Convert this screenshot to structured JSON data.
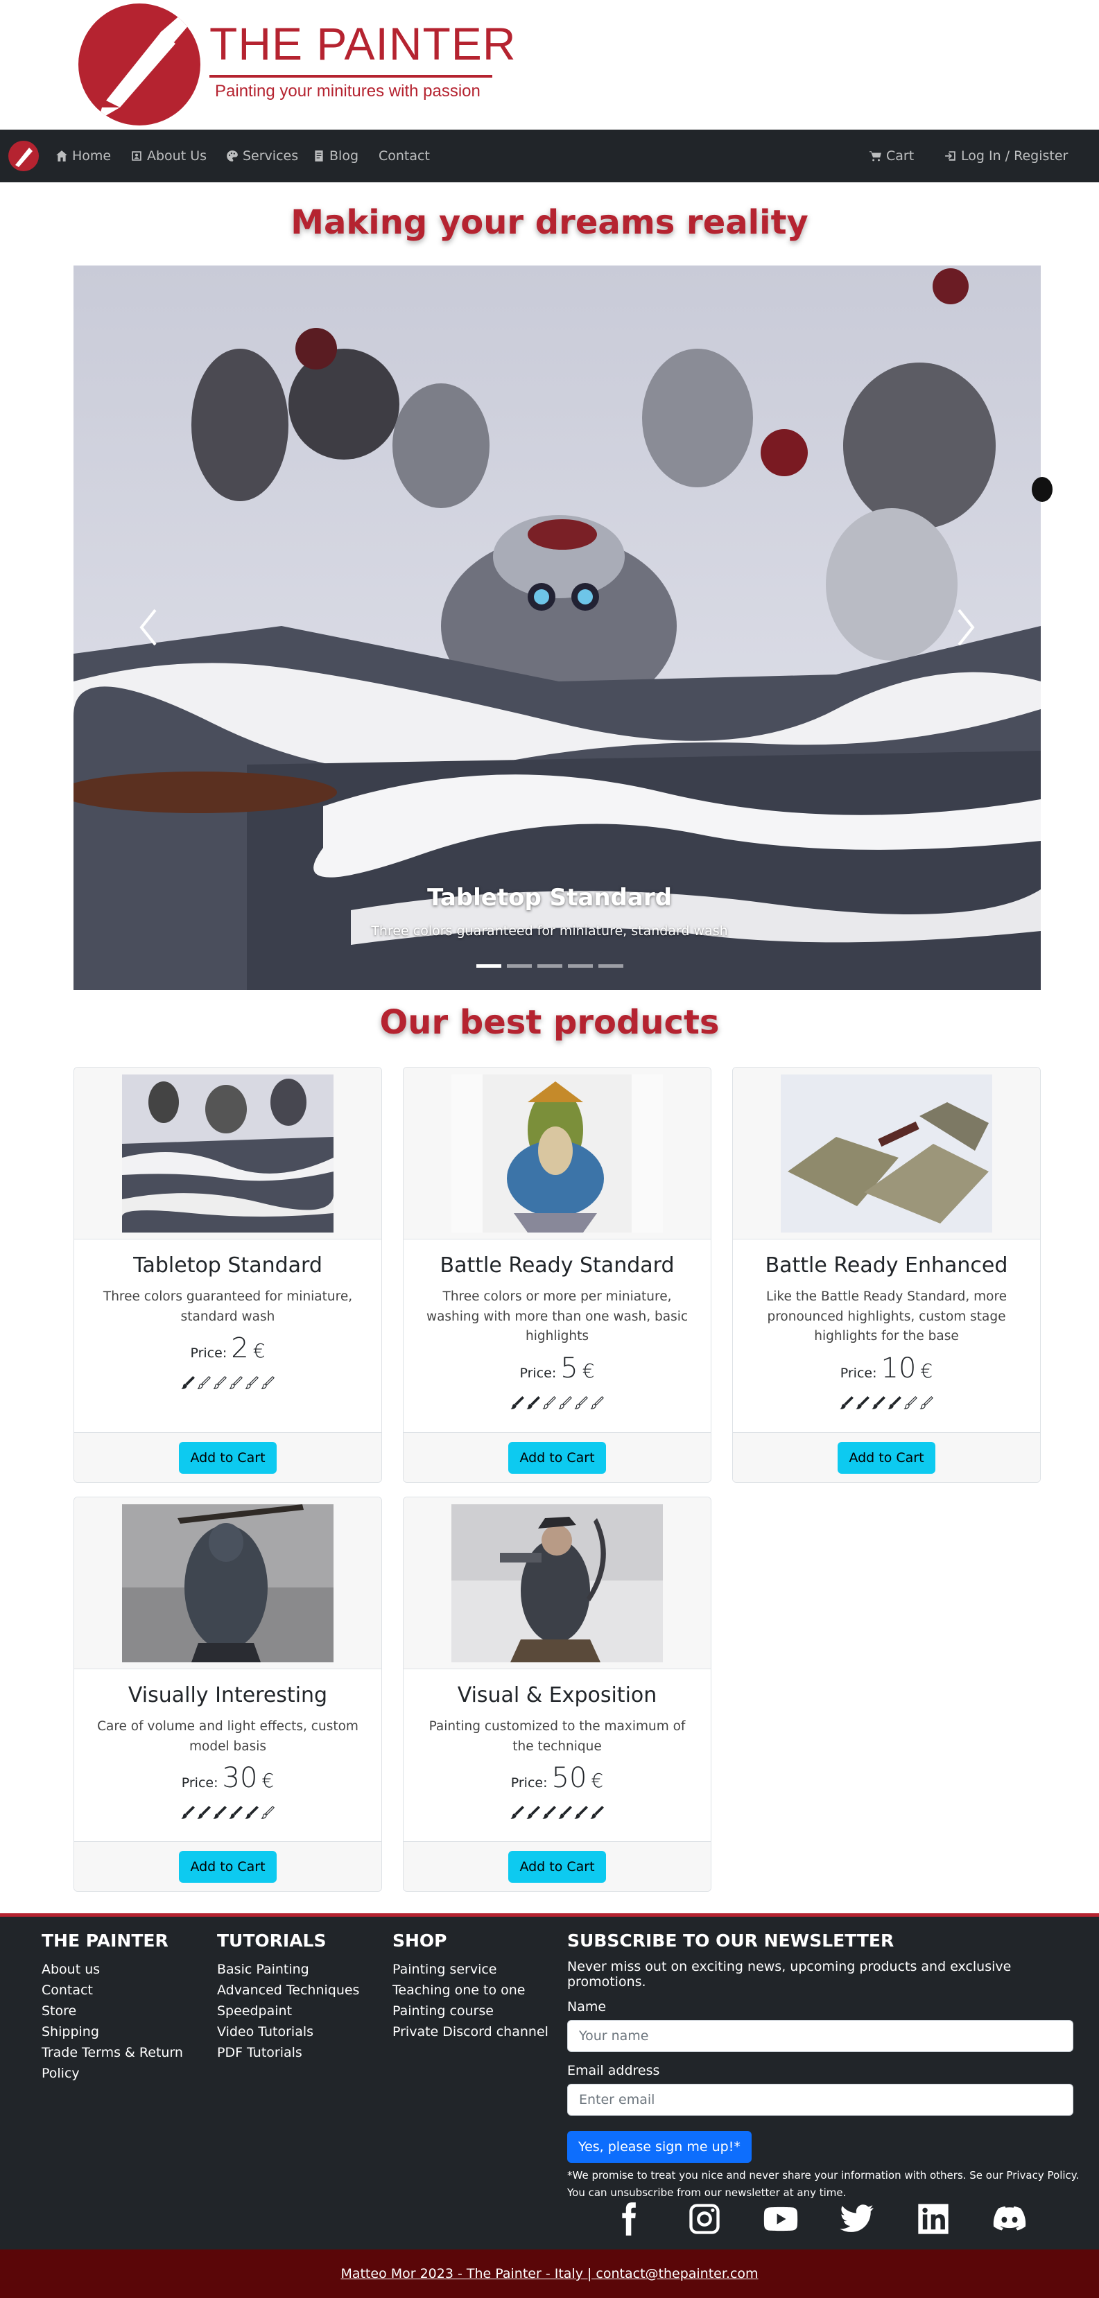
{
  "brand": {
    "title": "THE PAINTER",
    "tagline": "Painting your minitures with passion",
    "color": "#b52330"
  },
  "nav": {
    "items": [
      {
        "label": "Home",
        "icon": "house-icon"
      },
      {
        "label": "About Us",
        "icon": "person-badge-icon"
      },
      {
        "label": "Services",
        "icon": "palette-icon"
      },
      {
        "label": "Blog",
        "icon": "journal-icon"
      },
      {
        "label": "Contact",
        "icon": ""
      }
    ],
    "cart_label": "Cart",
    "login_label": "Log In / Register"
  },
  "hero": {
    "heading": "Making your dreams reality",
    "caption_title": "Tabletop Standard",
    "caption_text": "Three colors guaranteed for miniature, standard wash",
    "indicator_count": 5,
    "active_indicator": 1
  },
  "products": {
    "heading": "Our best products",
    "price_label": "Price:",
    "currency": "€",
    "button_label": "Add to Cart",
    "items": [
      {
        "title": "Tabletop Standard",
        "desc": "Three colors guaranteed for miniature, standard wash",
        "price": "2",
        "rating": 1,
        "max_rating": 6
      },
      {
        "title": "Battle Ready Standard",
        "desc": "Three colors or more per miniature, washing with more than one wash, basic highlights",
        "price": "5",
        "rating": 2,
        "max_rating": 6
      },
      {
        "title": "Battle Ready Enhanced",
        "desc": "Like the Battle Ready Standard, more pronounced highlights, custom stage highlights for the base",
        "price": "10",
        "rating": 4,
        "max_rating": 6
      },
      {
        "title": "Visually Interesting",
        "desc": "Care of volume and light effects, custom model basis",
        "price": "30",
        "rating": 5,
        "max_rating": 6
      },
      {
        "title": "Visual & Exposition",
        "desc": "Painting customized to the maximum of the technique",
        "price": "50",
        "rating": 6,
        "max_rating": 6
      }
    ]
  },
  "footer": {
    "col1": {
      "heading": "THE PAINTER",
      "links": [
        "About us",
        "Contact",
        "Store",
        "Shipping",
        "Trade Terms & Return",
        "Policy"
      ]
    },
    "col2": {
      "heading": "TUTORIALS",
      "links": [
        "Basic Painting",
        "Advanced Techniques",
        "Speedpaint",
        "Video Tutorials",
        "PDF Tutorials"
      ]
    },
    "col3": {
      "heading": "SHOP",
      "links": [
        "Painting service",
        "Teaching one to one",
        "Painting course",
        "Private Discord channel"
      ]
    },
    "newsletter": {
      "heading": "SUBSCRIBE TO OUR NEWSLETTER",
      "text": "Never miss out on exciting news, upcoming products and exclusive promotions.",
      "name_label": "Name",
      "name_placeholder": "Your name",
      "email_label": "Email address",
      "email_placeholder": "Enter email",
      "button": "Yes, please sign me up!*",
      "note_line1": "*We promise to treat you nice and never share your information with others. Se our Privacy Policy.",
      "note_line2": "You can unsubscribe from our newsletter at any time."
    },
    "socials": [
      "facebook-icon",
      "instagram-icon",
      "youtube-icon",
      "twitter-icon",
      "linkedin-icon",
      "discord-icon"
    ]
  },
  "bottom_bar": {
    "text": "Matteo Mor 2023 - The Painter - Italy | contact@thepainter.com",
    "background": "#5a0608"
  },
  "colors": {
    "navbar": "#212529",
    "cart_button": "#0dcaf0",
    "signup_button": "#0d6efd"
  }
}
